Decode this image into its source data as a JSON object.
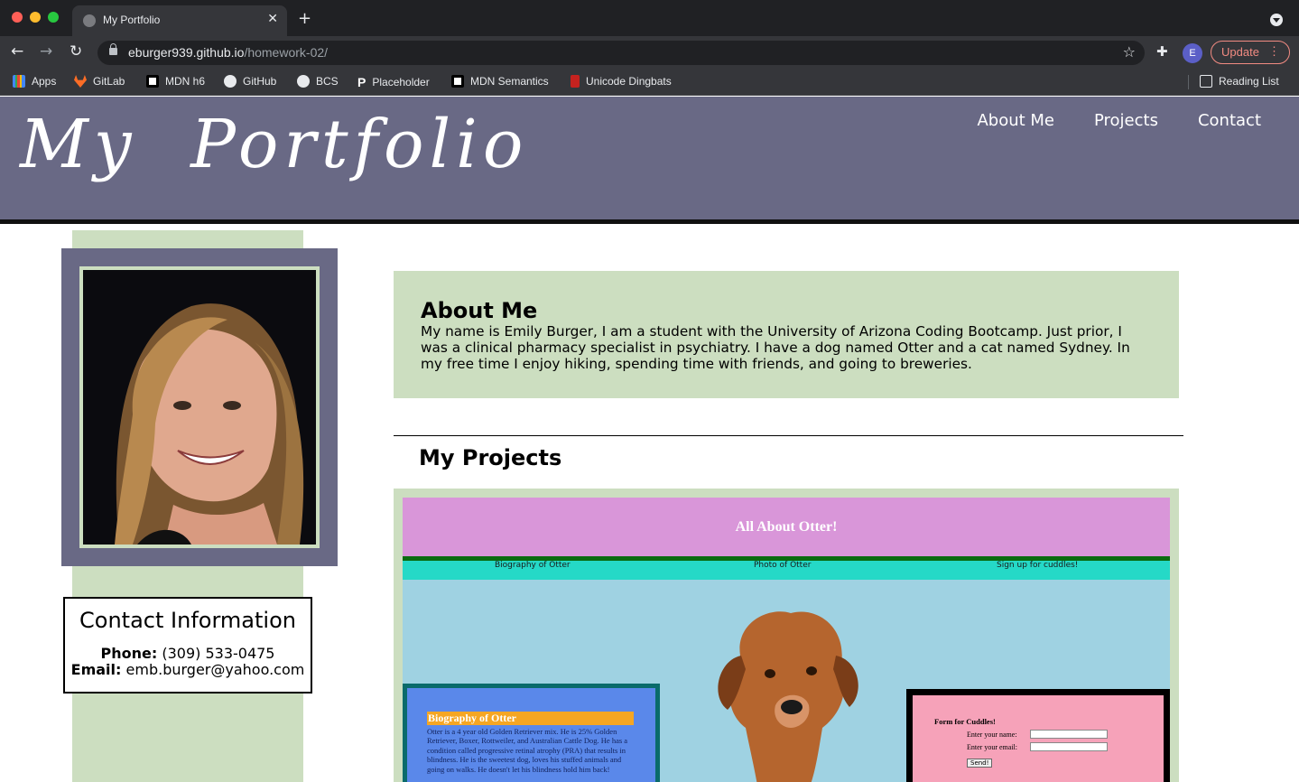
{
  "browser": {
    "tab_title": "My Portfolio",
    "url_host": "eburger939.github.io",
    "url_path": "/homework-02/",
    "update_label": "Update",
    "avatar_letter": "E",
    "bookmarks": [
      {
        "label": "Apps",
        "icon": "apps-grid-icon"
      },
      {
        "label": "GitLab",
        "icon": "gitlab-icon"
      },
      {
        "label": "MDN h6",
        "icon": "mdn-icon"
      },
      {
        "label": "GitHub",
        "icon": "github-icon"
      },
      {
        "label": "BCS",
        "icon": "globe-icon"
      },
      {
        "label": "Placeholder",
        "icon": "placeholder-icon"
      },
      {
        "label": "MDN Semantics",
        "icon": "mdn-icon"
      },
      {
        "label": "Unicode Dingbats",
        "icon": "unicode-icon"
      }
    ],
    "reading_list": "Reading List"
  },
  "site": {
    "title": "My Portfolio",
    "nav": [
      "About Me",
      "Projects",
      "Contact"
    ]
  },
  "contact": {
    "title": "Contact Information",
    "phone_label": "Phone:",
    "phone": "(309) 533-0475",
    "email_label": "Email:",
    "email": "emb.burger@yahoo.com"
  },
  "about": {
    "heading": "About Me",
    "line1": "My name is Emily Burger, I am a student with the University of Arizona Coding Bootcamp. Just prior, I",
    "line2": "was a clinical pharmacy specialist in psychiatry. I have a dog named Otter and a cat named Sydney. In",
    "line3": "my free time I enjoy hiking, spending time with friends, and going to breweries."
  },
  "projects": {
    "heading": "My Projects",
    "project1": {
      "title": "All About Otter!",
      "nav": [
        "Biography of Otter",
        "Photo of Otter",
        "Sign up for cuddles!"
      ],
      "bio_title": "Biography of Otter",
      "bio_text": "Otter is a 4 year old Golden Retriever mix. He is 25% Golden Retriever, Boxer, Rottweiler, and Australian Cattle Dog. He has a condition called progressive retinal atrophy (PRA) that results in blindness. He is the sweetest dog, loves his stuffed animals and going on walks. He doesn't let his blindness hold him back!",
      "form_title": "Form for Cuddles!",
      "form_name_label": "Enter your name:",
      "form_email_label": "Enter your email:",
      "form_send": "Send!"
    }
  },
  "colors": {
    "header_bg": "#696985",
    "sage": "#ccdec0",
    "project_header": "#d996d9"
  }
}
